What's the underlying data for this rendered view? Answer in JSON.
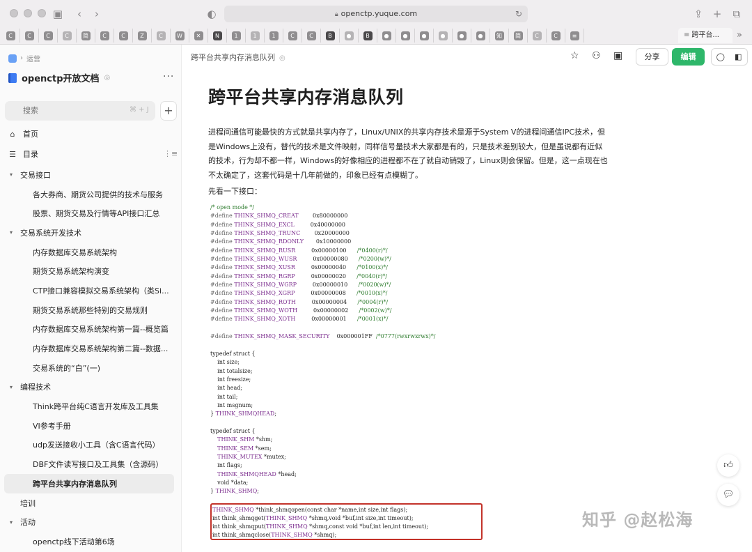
{
  "browser": {
    "url": "openctp.yuque.com",
    "tab_icons": [
      "C",
      "C",
      "C",
      "C",
      "简",
      "C",
      "C",
      "Z",
      "C",
      "W",
      "✕",
      "N",
      "1",
      "1",
      "1",
      "C",
      "C",
      "B",
      "●",
      "B",
      "●",
      "●",
      "●",
      "●",
      "●",
      "●",
      "知",
      "简",
      "C",
      "C",
      "≡"
    ],
    "active_tab": "跨平台..."
  },
  "sidebar": {
    "crumb": "运营",
    "book_title": "openctp开放文档",
    "search_placeholder": "搜索",
    "search_shortcut": "⌘ + J",
    "nav_home": "首页",
    "nav_toc": "目录",
    "items": [
      {
        "label": "交易接口",
        "kind": "group"
      },
      {
        "label": "各大券商、期货公司提供的技术与服务",
        "kind": "child"
      },
      {
        "label": "股票、期货交易及行情等API接口汇总",
        "kind": "child"
      },
      {
        "label": "交易系统开发技术",
        "kind": "group"
      },
      {
        "label": "内存数据库交易系统架构",
        "kind": "child"
      },
      {
        "label": "期货交易系统架构演变",
        "kind": "child"
      },
      {
        "label": "CTP接口兼容模拟交易系统架构（类Si...",
        "kind": "child"
      },
      {
        "label": "期货交易系统那些特别的交易规则",
        "kind": "child"
      },
      {
        "label": "内存数据库交易系统架构第一篇--概览篇",
        "kind": "child"
      },
      {
        "label": "内存数据库交易系统架构第二篇--数据...",
        "kind": "child"
      },
      {
        "label": "交易系统的“白”(一)",
        "kind": "child"
      },
      {
        "label": "编程技术",
        "kind": "group"
      },
      {
        "label": "Think跨平台纯C语言开发库及工具集",
        "kind": "child"
      },
      {
        "label": "VI参考手册",
        "kind": "child"
      },
      {
        "label": "udp发送接收小工具（含C语言代码）",
        "kind": "child"
      },
      {
        "label": "DBF文件读写接口及工具集（含源码）",
        "kind": "child"
      },
      {
        "label": "跨平台共享内存消息队列",
        "kind": "active"
      },
      {
        "label": "培训",
        "kind": "plain"
      },
      {
        "label": "活动",
        "kind": "group"
      },
      {
        "label": "openctp线下活动第6场",
        "kind": "child"
      }
    ]
  },
  "toolbar": {
    "doc_crumb": "跨平台共享内存消息队列",
    "share_label": "分享",
    "edit_label": "编辑"
  },
  "doc": {
    "title": "跨平台共享内存消息队列",
    "paragraph": "进程间通信可能最快的方式就是共享内存了，Linux/UNIX的共享内存技术是源于System V的进程间通信IPC技术，但是Windows上没有，替代的技术是文件映射，同样信号量技术大家都是有的，只是技术差别较大，但是虽说都有近似的技术，行为却不都一样，Windows的好像相应的进程都不在了就自动销毁了，Linux则会保留。但是，这一点现在也不太确定了，这套代码是十几年前做的，印象已经有点模糊了。",
    "intro": "先看一下接口：",
    "code_lines": [
      [
        [
          "c-com",
          "/* open mode */"
        ]
      ],
      [
        [
          "c-pp",
          "#define "
        ],
        [
          "c-id",
          "THINK_SHMQ_CREAT"
        ],
        [
          "",
          "        0x80000000"
        ]
      ],
      [
        [
          "c-pp",
          "#define "
        ],
        [
          "c-id",
          "THINK_SHMQ_EXCL"
        ],
        [
          "",
          "         0x40000000"
        ]
      ],
      [
        [
          "c-pp",
          "#define "
        ],
        [
          "c-id",
          "THINK_SHMQ_TRUNC"
        ],
        [
          "",
          "        0x20000000"
        ]
      ],
      [
        [
          "c-pp",
          "#define "
        ],
        [
          "c-id",
          "THINK_SHMQ_RDONLY"
        ],
        [
          "",
          "       0x10000000"
        ]
      ],
      [
        [
          "c-pp",
          "#define "
        ],
        [
          "c-id",
          "THINK_SHMQ_RUSR"
        ],
        [
          "",
          "         0x00000100      "
        ],
        [
          "c-com",
          "/*0400(r)*/"
        ]
      ],
      [
        [
          "c-pp",
          "#define "
        ],
        [
          "c-id",
          "THINK_SHMQ_WUSR"
        ],
        [
          "",
          "         0x00000080      "
        ],
        [
          "c-com",
          "/*0200(w)*/"
        ]
      ],
      [
        [
          "c-pp",
          "#define "
        ],
        [
          "c-id",
          "THINK_SHMQ_XUSR"
        ],
        [
          "",
          "         0x00000040      "
        ],
        [
          "c-com",
          "/*0100(x)*/"
        ]
      ],
      [
        [
          "c-pp",
          "#define "
        ],
        [
          "c-id",
          "THINK_SHMQ_RGRP"
        ],
        [
          "",
          "         0x00000020      "
        ],
        [
          "c-com",
          "/*0040(r)*/"
        ]
      ],
      [
        [
          "c-pp",
          "#define "
        ],
        [
          "c-id",
          "THINK_SHMQ_WGRP"
        ],
        [
          "",
          "         0x00000010      "
        ],
        [
          "c-com",
          "/*0020(w)*/"
        ]
      ],
      [
        [
          "c-pp",
          "#define "
        ],
        [
          "c-id",
          "THINK_SHMQ_XGRP"
        ],
        [
          "",
          "         0x00000008      "
        ],
        [
          "c-com",
          "/*0010(x)*/"
        ]
      ],
      [
        [
          "c-pp",
          "#define "
        ],
        [
          "c-id",
          "THINK_SHMQ_ROTH"
        ],
        [
          "",
          "         0x00000004      "
        ],
        [
          "c-com",
          "/*0004(r)*/"
        ]
      ],
      [
        [
          "c-pp",
          "#define "
        ],
        [
          "c-id",
          "THINK_SHMQ_WOTH"
        ],
        [
          "",
          "         0x00000002      "
        ],
        [
          "c-com",
          "/*0002(w)*/"
        ]
      ],
      [
        [
          "c-pp",
          "#define "
        ],
        [
          "c-id",
          "THINK_SHMQ_XOTH"
        ],
        [
          "",
          "         0x00000001      "
        ],
        [
          "c-com",
          "/*0001(x)*/"
        ]
      ],
      [],
      [
        [
          "c-pp",
          "#define "
        ],
        [
          "c-id",
          "THINK_SHMQ_MASK_SECURITY"
        ],
        [
          "",
          "    0x000001FF  "
        ],
        [
          "c-com",
          "/*0777(rwxrwxrwx)*/"
        ]
      ],
      [],
      [
        [
          "c-kw",
          "typedef struct {"
        ]
      ],
      [
        [
          "",
          "    int size;"
        ]
      ],
      [
        [
          "",
          "    int totalsize;"
        ]
      ],
      [
        [
          "",
          "    int freesize;"
        ]
      ],
      [
        [
          "",
          "    int head;"
        ]
      ],
      [
        [
          "",
          "    int tail;"
        ]
      ],
      [
        [
          "",
          "    int msgnum;"
        ]
      ],
      [
        [
          "",
          "} "
        ],
        [
          "c-id",
          "THINK_SHMQHEAD"
        ],
        [
          "",
          ";"
        ]
      ],
      [],
      [
        [
          "c-kw",
          "typedef struct {"
        ]
      ],
      [
        [
          "",
          "    "
        ],
        [
          "c-id",
          "THINK_SHM"
        ],
        [
          "",
          " *shm;"
        ]
      ],
      [
        [
          "",
          "    "
        ],
        [
          "c-id",
          "THINK_SEM"
        ],
        [
          "",
          " *sem;"
        ]
      ],
      [
        [
          "",
          "    "
        ],
        [
          "c-id",
          "THINK_MUTEX"
        ],
        [
          "",
          " *mutex;"
        ]
      ],
      [
        [
          "",
          "    int flags;"
        ]
      ],
      [
        [
          "",
          "    "
        ],
        [
          "c-id",
          "THINK_SHMQHEAD"
        ],
        [
          "",
          " *head;"
        ]
      ],
      [
        [
          "",
          "    void *data;"
        ]
      ],
      [
        [
          "",
          "} "
        ],
        [
          "c-id",
          "THINK_SHMQ"
        ],
        [
          "",
          ";"
        ]
      ]
    ],
    "boxed_lines": [
      [
        [
          "c-id",
          "THINK_SHMQ"
        ],
        [
          "",
          " *think_shmqopen(const char *name,int size,int flags);"
        ]
      ],
      [
        [
          "",
          "int think_shmqget("
        ],
        [
          "c-id",
          "THINK_SHMQ"
        ],
        [
          "",
          " *shmq,void *buf,int size,int timeout);"
        ]
      ],
      [
        [
          "",
          "int think_shmqput("
        ],
        [
          "c-id",
          "THINK_SHMQ"
        ],
        [
          "",
          " *shmq,const void *buf,int len,int timeout);"
        ]
      ],
      [
        [
          "",
          "int think_shmqclose("
        ],
        [
          "c-id",
          "THINK_SHMQ"
        ],
        [
          "",
          " *shmq);"
        ]
      ]
    ],
    "watermark": "知乎 @赵松海"
  }
}
